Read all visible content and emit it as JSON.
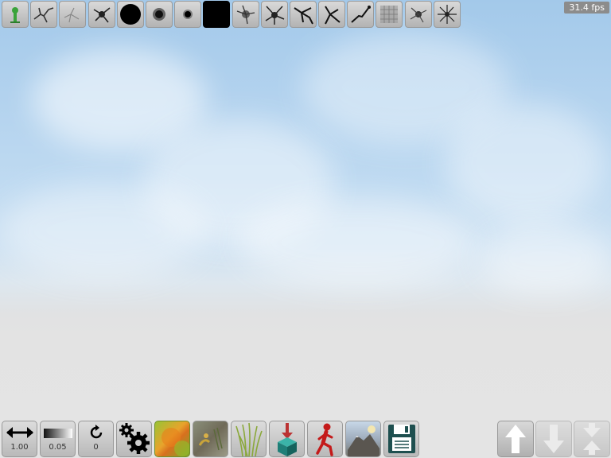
{
  "fps": "31.4 fps",
  "brushes": [
    {
      "icon": "tree-brush-icon",
      "selected": false
    },
    {
      "icon": "crack-brush-icon",
      "selected": false
    },
    {
      "icon": "faint-crack-brush-icon",
      "selected": false
    },
    {
      "icon": "splat-brush-icon",
      "selected": false
    },
    {
      "icon": "large-round-brush-icon",
      "selected": false
    },
    {
      "icon": "medium-soft-brush-icon",
      "selected": false
    },
    {
      "icon": "small-round-brush-icon",
      "selected": false
    },
    {
      "icon": "square-brush-icon",
      "selected": true
    },
    {
      "icon": "splatter-brush-icon",
      "selected": false
    },
    {
      "icon": "star-splat-brush-icon",
      "selected": false
    },
    {
      "icon": "branch-brush-icon",
      "selected": false
    },
    {
      "icon": "root-brush-icon",
      "selected": false
    },
    {
      "icon": "line-brush-icon",
      "selected": false
    },
    {
      "icon": "noise-brush-icon",
      "selected": false
    },
    {
      "icon": "scatter-brush-icon",
      "selected": false
    },
    {
      "icon": "burst-brush-icon",
      "selected": false
    }
  ],
  "tools": {
    "size": {
      "icon": "resize-arrows-icon",
      "value": "1.00"
    },
    "opacity": {
      "icon": "gradient-icon",
      "value": "0.05"
    },
    "rotation": {
      "icon": "rotate-icon",
      "value": "0"
    },
    "settings": {
      "icon": "gears-icon"
    },
    "terrain_texture": {
      "icon": "terrain-texture-icon"
    },
    "detail_texture": {
      "icon": "detail-texture-icon"
    },
    "grass": {
      "icon": "grass-icon"
    },
    "object": {
      "icon": "place-object-icon"
    },
    "walk": {
      "icon": "walk-icon"
    },
    "terrain_view": {
      "icon": "terrain-view-icon"
    },
    "save": {
      "icon": "save-disk-icon"
    }
  },
  "nav": {
    "up": {
      "icon": "up-arrow-icon"
    },
    "down": {
      "icon": "down-arrow-icon",
      "disabled": true
    },
    "flatten": {
      "icon": "flatten-arrows-icon",
      "disabled": true
    }
  }
}
